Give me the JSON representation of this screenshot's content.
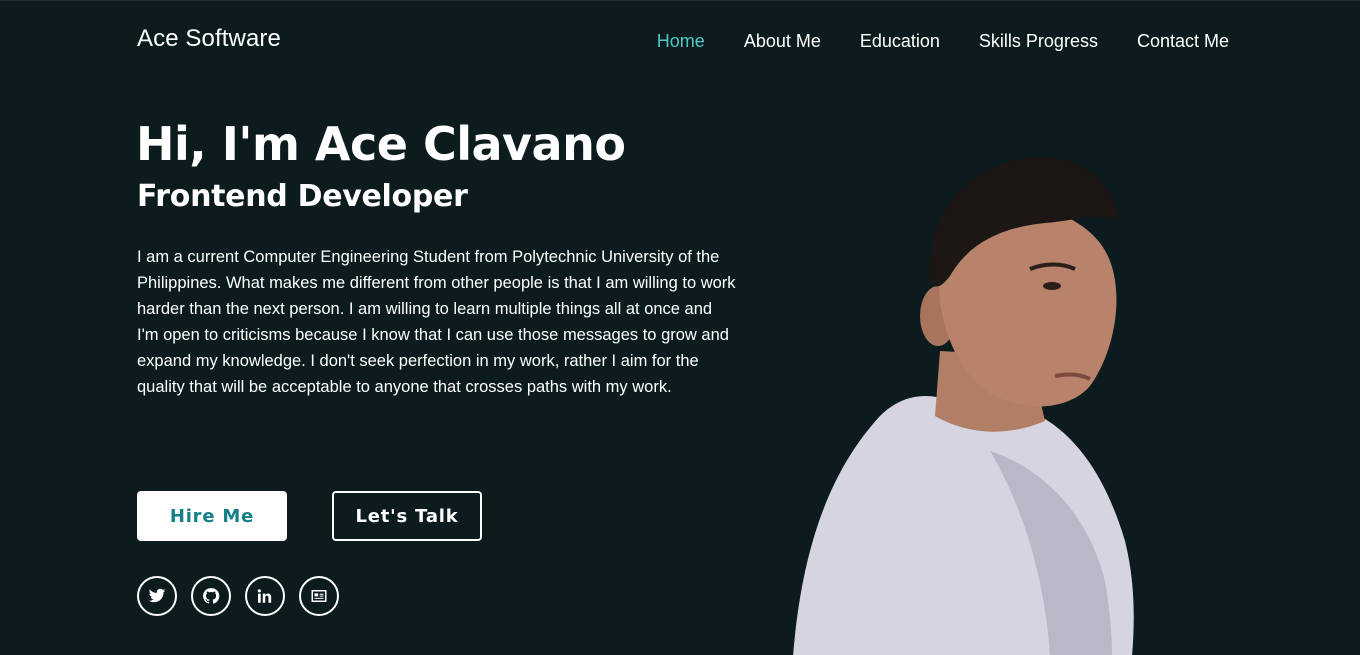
{
  "header": {
    "logo": "Ace Software",
    "nav": [
      {
        "label": "Home",
        "active": true
      },
      {
        "label": "About Me",
        "active": false
      },
      {
        "label": "Education",
        "active": false
      },
      {
        "label": "Skills Progress",
        "active": false
      },
      {
        "label": "Contact Me",
        "active": false
      }
    ]
  },
  "hero": {
    "title": "Hi, I'm Ace Clavano",
    "subtitle": "Frontend Developer",
    "bio": "I am a current Computer Engineering Student from Polytechnic University of the Philippines. What makes me different from other people is that I am willing to work harder than the next person. I am willing to learn multiple things all at once and I'm open to criticisms because I know that I can use those messages to grow and expand my knowledge. I don't seek perfection in my work, rather I aim for the quality that will be acceptable to anyone that crosses paths with my work.",
    "hire_label": "Hire Me",
    "talk_label": "Let's Talk"
  },
  "socials": [
    {
      "icon": "twitter-icon"
    },
    {
      "icon": "github-icon"
    },
    {
      "icon": "linkedin-icon"
    },
    {
      "icon": "id-card-icon"
    }
  ],
  "colors": {
    "background": "#0c1c1e",
    "accent": "#4fc6c8",
    "button_text": "#137f86"
  }
}
